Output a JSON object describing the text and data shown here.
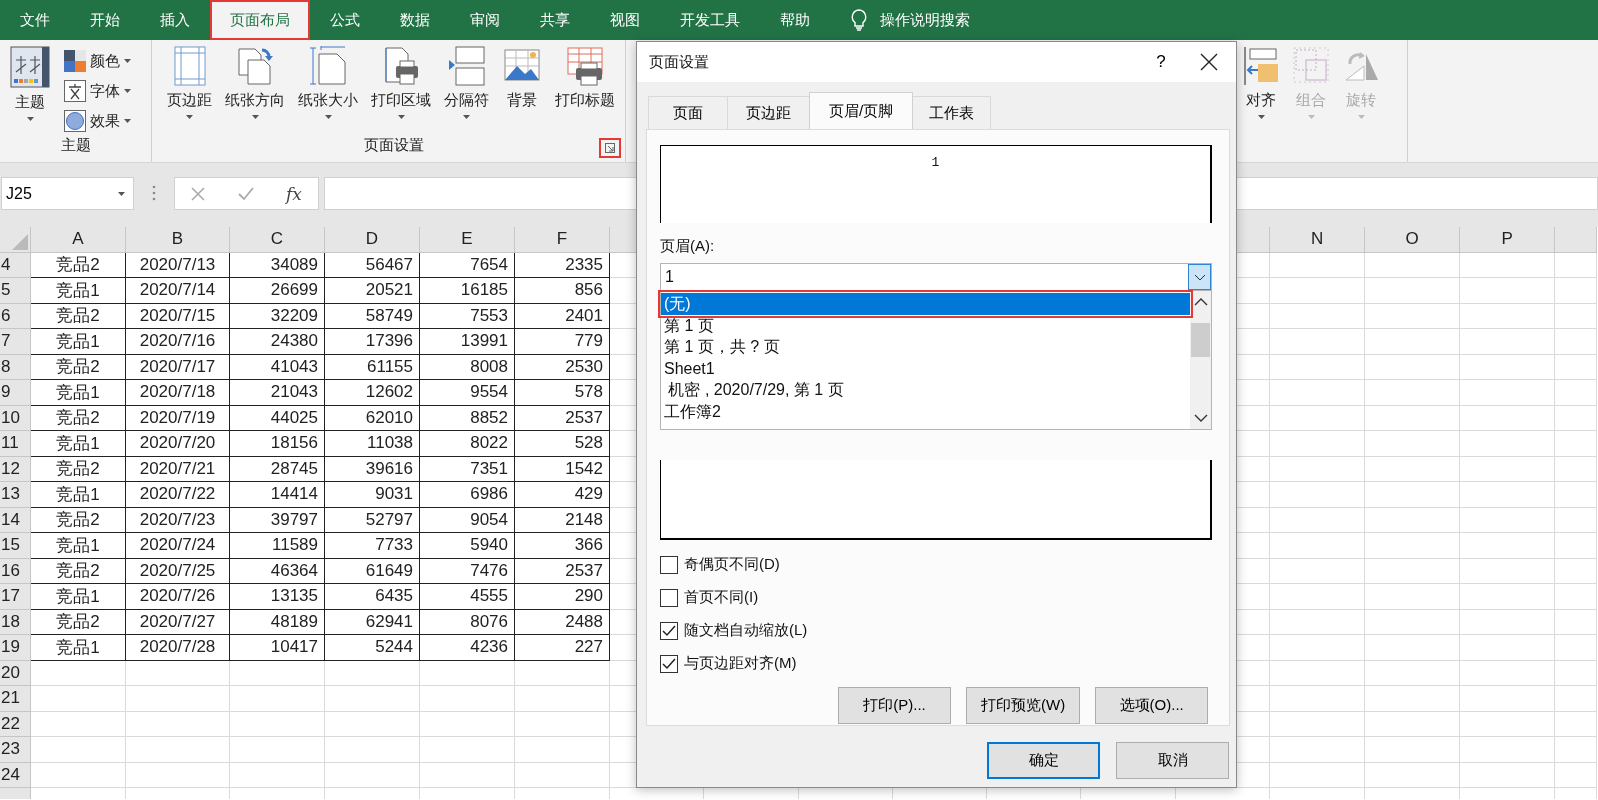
{
  "ribbon_tabs": [
    {
      "label": "文件",
      "selected": false,
      "highlighted": false
    },
    {
      "label": "开始",
      "selected": false,
      "highlighted": false
    },
    {
      "label": "插入",
      "selected": false,
      "highlighted": false
    },
    {
      "label": "页面布局",
      "selected": true,
      "highlighted": true
    },
    {
      "label": "公式",
      "selected": false,
      "highlighted": false
    },
    {
      "label": "数据",
      "selected": false,
      "highlighted": false
    },
    {
      "label": "审阅",
      "selected": false,
      "highlighted": false
    },
    {
      "label": "共享",
      "selected": false,
      "highlighted": false
    },
    {
      "label": "视图",
      "selected": false,
      "highlighted": false
    },
    {
      "label": "开发工具",
      "selected": false,
      "highlighted": false
    },
    {
      "label": "帮助",
      "selected": false,
      "highlighted": false
    }
  ],
  "tell_me": "操作说明搜索",
  "theme_group": {
    "label": "主题",
    "button": {
      "label": "主题",
      "dropdown": true
    },
    "small_buttons": [
      {
        "label": "颜色",
        "kind": "colors"
      },
      {
        "label": "字体",
        "kind": "fonts"
      },
      {
        "label": "效果",
        "kind": "effects"
      }
    ]
  },
  "page_setup_group": {
    "label": "页面设置",
    "launcher": {
      "highlighted": true
    },
    "buttons": [
      {
        "label": "页边距",
        "kind": "margins",
        "dropdown": true
      },
      {
        "label": "纸张方向",
        "kind": "orientation",
        "dropdown": true
      },
      {
        "label": "纸张大小",
        "kind": "size",
        "dropdown": true
      },
      {
        "label": "打印区域",
        "kind": "print-area",
        "dropdown": true
      },
      {
        "label": "分隔符",
        "kind": "breaks",
        "dropdown": true
      },
      {
        "label": "背景",
        "kind": "background",
        "dropdown": false
      },
      {
        "label": "打印标题",
        "kind": "print-titles",
        "dropdown": false
      }
    ]
  },
  "arrange_group": {
    "buttons": [
      {
        "label": "对齐",
        "kind": "align",
        "dropdown": true,
        "disabled": false
      },
      {
        "label": "组合",
        "kind": "group",
        "dropdown": true,
        "disabled": true
      },
      {
        "label": "旋转",
        "kind": "rotate",
        "dropdown": true,
        "disabled": true
      }
    ]
  },
  "formula_bar": {
    "name_box": "J25",
    "function_label": "fx"
  },
  "sheet": {
    "columns_left": [
      "A",
      "B",
      "C",
      "D",
      "E",
      "F"
    ],
    "columns_right": [
      "N",
      "O",
      "P"
    ],
    "rows": [
      {
        "number": "4",
        "cells": [
          "竞品2",
          "2020/7/13",
          "34089",
          "56467",
          "7654",
          "2335"
        ]
      },
      {
        "number": "5",
        "cells": [
          "竞品1",
          "2020/7/14",
          "26699",
          "20521",
          "16185",
          "856"
        ]
      },
      {
        "number": "6",
        "cells": [
          "竞品2",
          "2020/7/15",
          "32209",
          "58749",
          "7553",
          "2401"
        ]
      },
      {
        "number": "7",
        "cells": [
          "竞品1",
          "2020/7/16",
          "24380",
          "17396",
          "13991",
          "779"
        ]
      },
      {
        "number": "8",
        "cells": [
          "竞品2",
          "2020/7/17",
          "41043",
          "61155",
          "8008",
          "2530"
        ]
      },
      {
        "number": "9",
        "cells": [
          "竞品1",
          "2020/7/18",
          "21043",
          "12602",
          "9554",
          "578"
        ]
      },
      {
        "number": "10",
        "cells": [
          "竞品2",
          "2020/7/19",
          "44025",
          "62010",
          "8852",
          "2537"
        ]
      },
      {
        "number": "11",
        "cells": [
          "竞品1",
          "2020/7/20",
          "18156",
          "11038",
          "8022",
          "528"
        ]
      },
      {
        "number": "12",
        "cells": [
          "竞品2",
          "2020/7/21",
          "28745",
          "39616",
          "7351",
          "1542"
        ]
      },
      {
        "number": "13",
        "cells": [
          "竞品1",
          "2020/7/22",
          "14414",
          "9031",
          "6986",
          "429"
        ]
      },
      {
        "number": "14",
        "cells": [
          "竞品2",
          "2020/7/23",
          "39797",
          "52797",
          "9054",
          "2148"
        ]
      },
      {
        "number": "15",
        "cells": [
          "竞品1",
          "2020/7/24",
          "11589",
          "7733",
          "5940",
          "366"
        ]
      },
      {
        "number": "16",
        "cells": [
          "竞品2",
          "2020/7/25",
          "46364",
          "61649",
          "7476",
          "2537"
        ]
      },
      {
        "number": "17",
        "cells": [
          "竞品1",
          "2020/7/26",
          "13135",
          "6435",
          "4555",
          "290"
        ]
      },
      {
        "number": "18",
        "cells": [
          "竞品2",
          "2020/7/27",
          "48189",
          "62941",
          "8076",
          "2488"
        ]
      },
      {
        "number": "19",
        "cells": [
          "竞品1",
          "2020/7/28",
          "10417",
          "5244",
          "4236",
          "227"
        ]
      },
      {
        "number": "20",
        "cells": []
      },
      {
        "number": "21",
        "cells": []
      },
      {
        "number": "22",
        "cells": []
      },
      {
        "number": "23",
        "cells": []
      },
      {
        "number": "24",
        "cells": []
      }
    ]
  },
  "dialog": {
    "title": "页面设置",
    "help": "?",
    "tabs": [
      {
        "label": "页面",
        "selected": false
      },
      {
        "label": "页边距",
        "selected": false
      },
      {
        "label": "页眉/页脚",
        "selected": true
      },
      {
        "label": "工作表",
        "selected": false
      }
    ],
    "header_preview": "1",
    "header_label": "页眉(A):",
    "header_value": "1",
    "header_options": [
      {
        "label": "(无)",
        "selected": true,
        "highlighted": true
      },
      {
        "label": "第 1 页",
        "selected": false,
        "highlighted": false
      },
      {
        "label": "第 1 页，共 ? 页",
        "selected": false,
        "highlighted": false
      },
      {
        "label": "Sheet1",
        "selected": false,
        "highlighted": false
      },
      {
        "label": " 机密 , 2020/7/29, 第 1 页",
        "selected": false,
        "highlighted": false
      },
      {
        "label": "工作簿2",
        "selected": false,
        "highlighted": false
      }
    ],
    "checkboxes": [
      {
        "label": "奇偶页不同(D)",
        "checked": false
      },
      {
        "label": "首页不同(I)",
        "checked": false
      },
      {
        "label": "随文档自动缩放(L)",
        "checked": true
      },
      {
        "label": "与页边距对齐(M)",
        "checked": true
      }
    ],
    "buttons": [
      "打印(P)...",
      "打印预览(W)",
      "选项(O)..."
    ],
    "footer_buttons": [
      {
        "label": "确定",
        "default": true
      },
      {
        "label": "取消",
        "default": false
      }
    ]
  }
}
